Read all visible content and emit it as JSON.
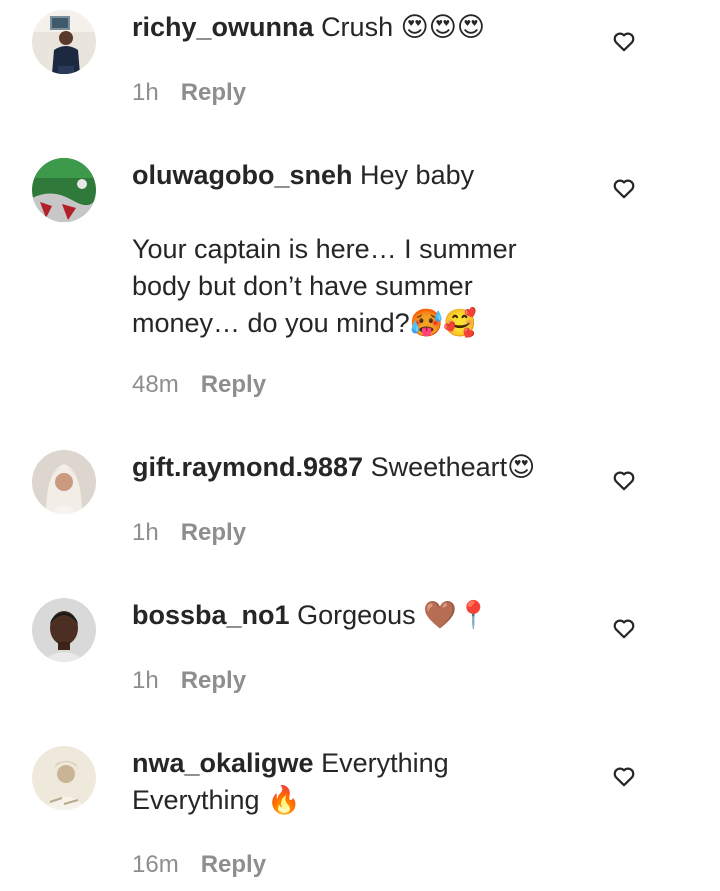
{
  "comments": [
    {
      "username": "richy_owunna",
      "text": "Crush 😍😍😍",
      "time": "1h",
      "reply_label": "Reply"
    },
    {
      "username": "oluwagobo_sneh",
      "text": "Hey baby\n\nYour captain is here… I summer body but don’t have summer money… do you mind?🥵🥰",
      "time": "48m",
      "reply_label": "Reply"
    },
    {
      "username": "gift.raymond.9887",
      "text": "Sweetheart😍",
      "time": "1h",
      "reply_label": "Reply"
    },
    {
      "username": "bossba_no1",
      "text": "Gorgeous 🤎📍",
      "time": "1h",
      "reply_label": "Reply"
    },
    {
      "username": "nwa_okaligwe",
      "text": "Everything Everything 🔥",
      "time": "16m",
      "reply_label": "Reply"
    }
  ],
  "icons": {
    "like": "heart-outline-icon"
  },
  "colors": {
    "text": "#262626",
    "muted": "#8e8e8e",
    "background": "#ffffff"
  }
}
